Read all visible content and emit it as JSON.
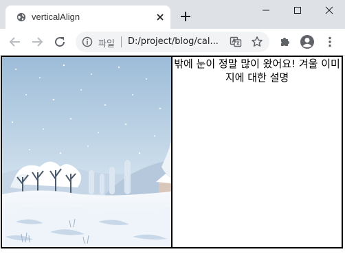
{
  "tab": {
    "title": "verticalAlign",
    "favicon": "globe-icon"
  },
  "omnibox": {
    "scheme_label": "파일",
    "url": "D:/project/blog/cal..."
  },
  "content": {
    "caption": "밖에 눈이 정말 많이 왔어요! 겨울 이미지에 대한 설명",
    "image_subject": "snowy winter landscape illustration"
  },
  "colors": {
    "tab_strip": "#dee1e6",
    "omnibox": "#f1f3f4",
    "table_border": "#000000",
    "sky_top": "#a6c3dc",
    "sky_bottom": "#e5eef6",
    "snow": "#f4f8fb"
  }
}
